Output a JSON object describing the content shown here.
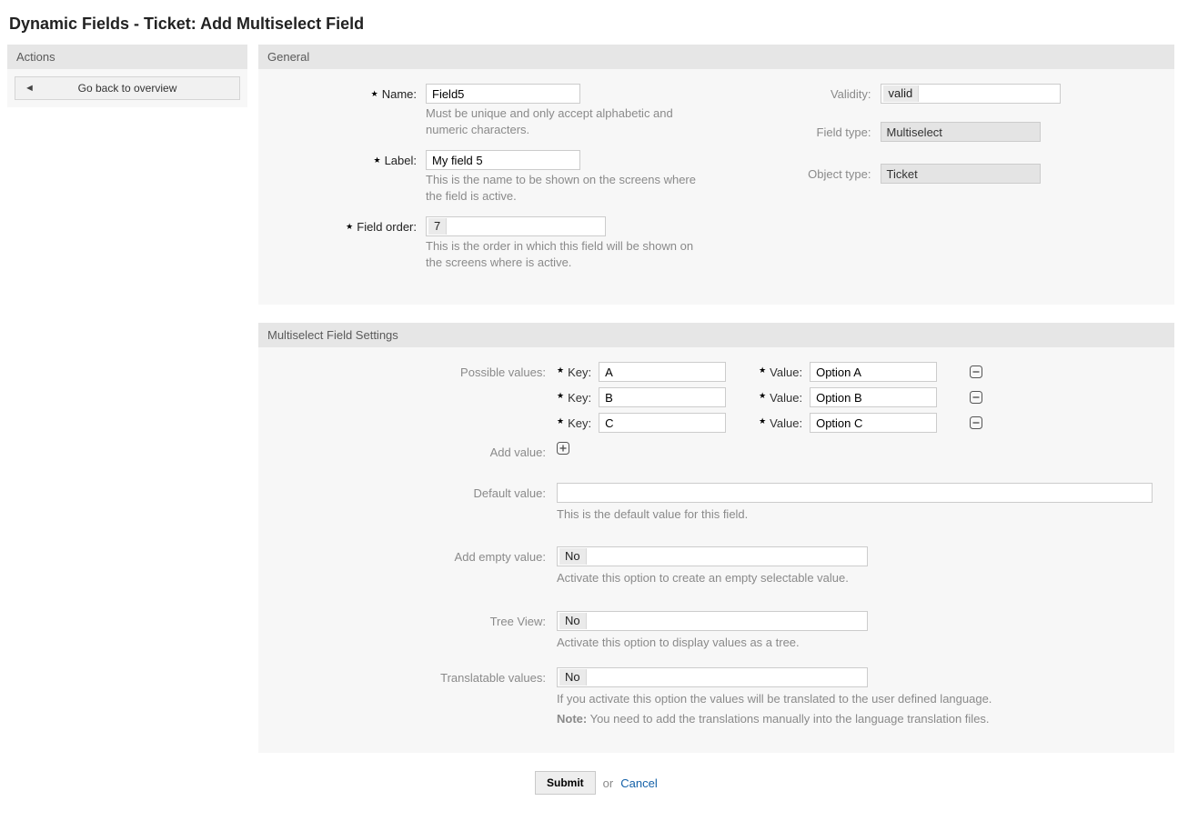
{
  "page_title": "Dynamic Fields - Ticket: Add Multiselect Field",
  "sidebar": {
    "header": "Actions",
    "back_label": "Go back to overview"
  },
  "general": {
    "header": "General",
    "name_label": "Name:",
    "name_value": "Field5",
    "name_help": "Must be unique and only accept alphabetic and numeric characters.",
    "label_label": "Label:",
    "label_value": "My field 5",
    "label_help": "This is the name to be shown on the screens where the field is active.",
    "order_label": "Field order:",
    "order_value": "7",
    "order_help": "This is the order in which this field will be shown on the screens where is active.",
    "validity_label": "Validity:",
    "validity_value": "valid",
    "fieldtype_label": "Field type:",
    "fieldtype_value": "Multiselect",
    "objecttype_label": "Object type:",
    "objecttype_value": "Ticket"
  },
  "settings": {
    "header": "Multiselect Field Settings",
    "possible_values_label": "Possible values:",
    "key_label": "Key:",
    "value_label": "Value:",
    "rows": [
      {
        "key": "A",
        "value": "Option A"
      },
      {
        "key": "B",
        "value": "Option B"
      },
      {
        "key": "C",
        "value": "Option C"
      }
    ],
    "add_value_label": "Add value:",
    "default_value_label": "Default value:",
    "default_value_value": "",
    "default_value_help": "This is the default value for this field.",
    "add_empty_label": "Add empty value:",
    "add_empty_value": "No",
    "add_empty_help": "Activate this option to create an empty selectable value.",
    "tree_view_label": "Tree View:",
    "tree_view_value": "No",
    "tree_view_help": "Activate this option to display values as a tree.",
    "translatable_label": "Translatable values:",
    "translatable_value": "No",
    "translatable_help1": "If you activate this option the values will be translated to the user defined language.",
    "translatable_note_bold": "Note:",
    "translatable_note_rest": " You need to add the translations manually into the language translation files."
  },
  "footer": {
    "submit": "Submit",
    "or": "or",
    "cancel": "Cancel"
  }
}
